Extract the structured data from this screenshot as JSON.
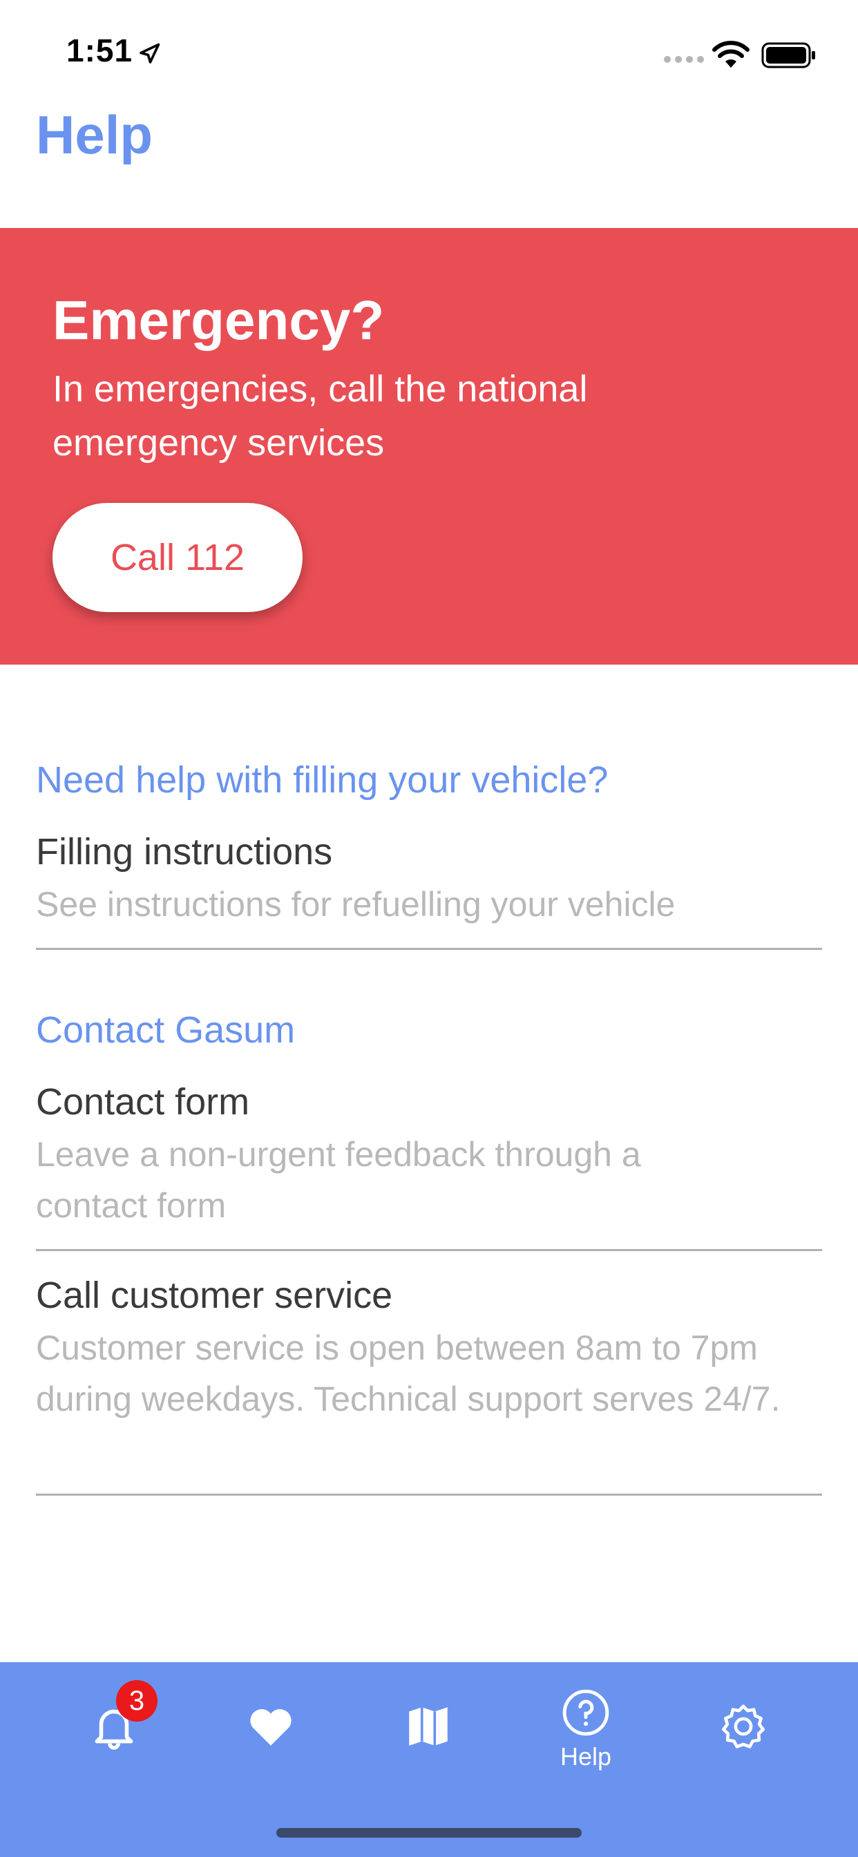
{
  "status_bar": {
    "time": "1:51"
  },
  "page": {
    "title": "Help"
  },
  "emergency": {
    "title": "Emergency?",
    "text": "In emergencies, call the national emergency services",
    "button_label": "Call 112"
  },
  "sections": [
    {
      "heading": "Need help with filling your vehicle?",
      "items": [
        {
          "title": "Filling instructions",
          "description": "See instructions for refuelling your vehicle"
        }
      ]
    },
    {
      "heading": "Contact Gasum",
      "items": [
        {
          "title": "Contact form",
          "description": "Leave a non-urgent feedback through a contact form"
        },
        {
          "title": "Call customer service",
          "description": "Customer service is open between 8am to 7pm during weekdays. Technical support serves 24/7."
        }
      ]
    }
  ],
  "tabbar": {
    "notifications_badge": "3",
    "tabs": [
      {
        "icon": "bell-icon",
        "label": ""
      },
      {
        "icon": "heart-icon",
        "label": ""
      },
      {
        "icon": "map-icon",
        "label": ""
      },
      {
        "icon": "help-circle-icon",
        "label": "Help"
      },
      {
        "icon": "gear-icon",
        "label": ""
      }
    ]
  },
  "colors": {
    "accent": "#6a93ef",
    "emergency": "#e94e55",
    "badge": "#e9191c"
  }
}
